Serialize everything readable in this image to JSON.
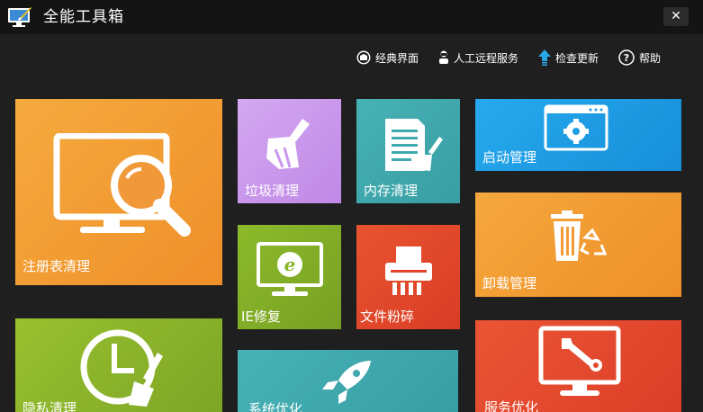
{
  "window": {
    "title": "全能工具箱",
    "close_glyph": "✕"
  },
  "toplinks": {
    "classic": "经典界面",
    "remote": "人工远程服务",
    "update": "检查更新",
    "help": "帮助"
  },
  "tiles": {
    "registry": "注册表清理",
    "privacy": "隐私清理",
    "junk": "垃圾清理",
    "memory": "内存清理",
    "ie": "IE修复",
    "shred": "文件粉碎",
    "system": "系统优化",
    "startup": "启动管理",
    "uninstall": "卸载管理",
    "service": "服务优化"
  },
  "colors": {
    "orange": "#f29d33",
    "green": "#8ab52a",
    "purple": "#c996ec",
    "teal": "#3fa9ae",
    "red": "#e2452b",
    "blue": "#1e9ee6",
    "orange2": "#f29a35",
    "red2": "#e6492f"
  }
}
